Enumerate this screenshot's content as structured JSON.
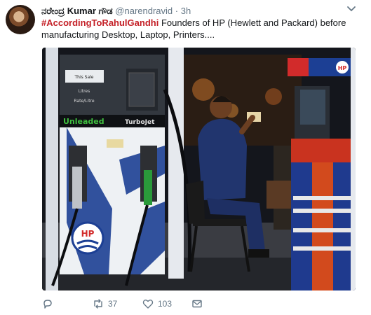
{
  "user": {
    "display_name": "ನರೇಂದ್ರ Kumar ಗೌಡ",
    "handle": "@narendravid",
    "time": "3h"
  },
  "tweet": {
    "hashtag": "#AccordingToRahulGandhi",
    "text": " Founders of HP (Hewlett and Packard) before manufacturing Desktop, Laptop, Printers...."
  },
  "media": {
    "pump_price_label": "This Sale",
    "pump_litres_label": "Litres",
    "pump_rate_label": "Rate/Litre",
    "unleaded_label": "Unleaded",
    "turbojet_label": "TurboJet",
    "hp_logo_text": "HP",
    "canopy_sign": "HP"
  },
  "actions": {
    "reply_icon": "reply-icon",
    "retweet_count": "37",
    "like_count": "103",
    "message_icon": "direct-message-icon"
  },
  "colors": {
    "hashtag": "#c42027",
    "muted": "#657786",
    "hp_blue": "#1c3f94",
    "hp_red": "#d22b2b"
  }
}
